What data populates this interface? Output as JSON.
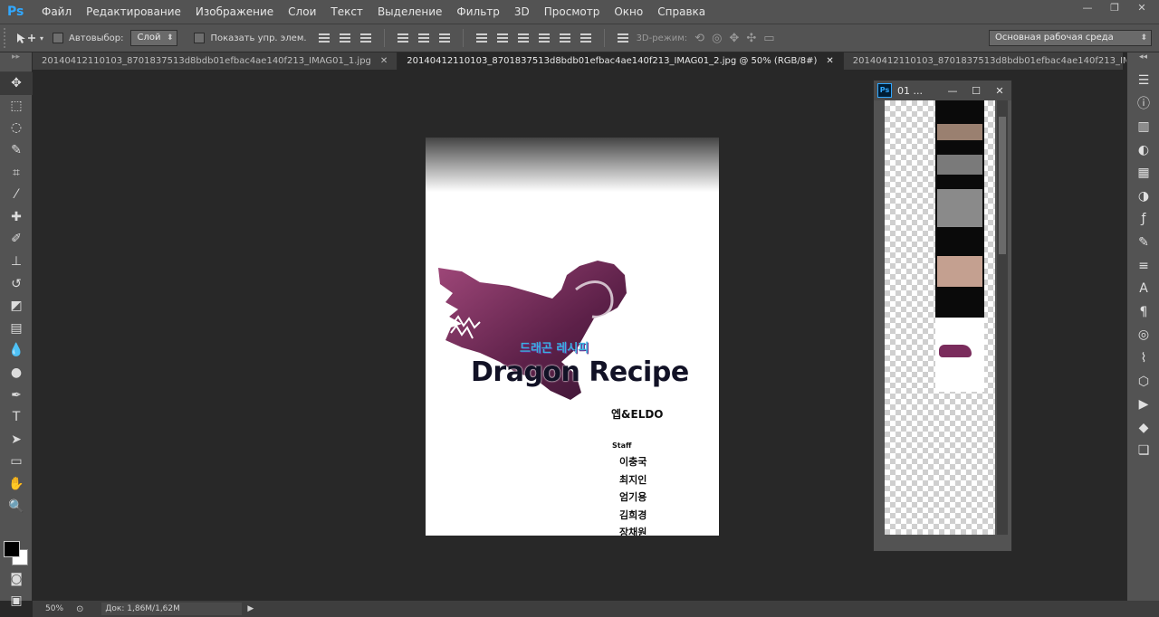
{
  "app": {
    "logo": "Ps"
  },
  "menu": [
    "Файл",
    "Редактирование",
    "Изображение",
    "Слои",
    "Текст",
    "Выделение",
    "Фильтр",
    "3D",
    "Просмотр",
    "Окно",
    "Справка"
  ],
  "window_controls": {
    "minimize": "—",
    "restore": "❐",
    "close": "✕"
  },
  "options": {
    "autoselect_label": "Автовыбор:",
    "autoselect_value": "Слой",
    "show_transform_label": "Показать упр. элем.",
    "mode3d_label": "3D-режим:",
    "workspace_value": "Основная рабочая среда"
  },
  "tabs": [
    {
      "label": "20140412110103_8701837513d8bdb01efbac4ae140f213_IMAG01_1.jpg",
      "close": "✕"
    },
    {
      "label": "20140412110103_8701837513d8bdb01efbac4ae140f213_IMAG01_2.jpg @ 50% (RGB/8#)",
      "close": "✕"
    },
    {
      "label": "20140412110103_8701837513d8bdb01efbac4ae140f213_IMAG01_3.jpg",
      "close": "✕"
    }
  ],
  "tabs_overflow": "»",
  "canvas": {
    "sub_title": "드래곤 레시피",
    "title": "Dragon Recipe",
    "author": "엡&ELDO",
    "staff_label": "Staff",
    "staff": [
      "이충국",
      "최지인",
      "엄기용",
      "김희경",
      "장채원"
    ]
  },
  "status": {
    "zoom": "50%",
    "doc": "Док: 1,86M/1,62M",
    "arrow": "▶"
  },
  "float_window": {
    "logo": "Ps",
    "title": "01 ...",
    "minimize": "—",
    "maximize": "☐",
    "close": "✕"
  },
  "colors": {
    "accent": "#31a8ff",
    "dragon": "#7a2c5c"
  }
}
